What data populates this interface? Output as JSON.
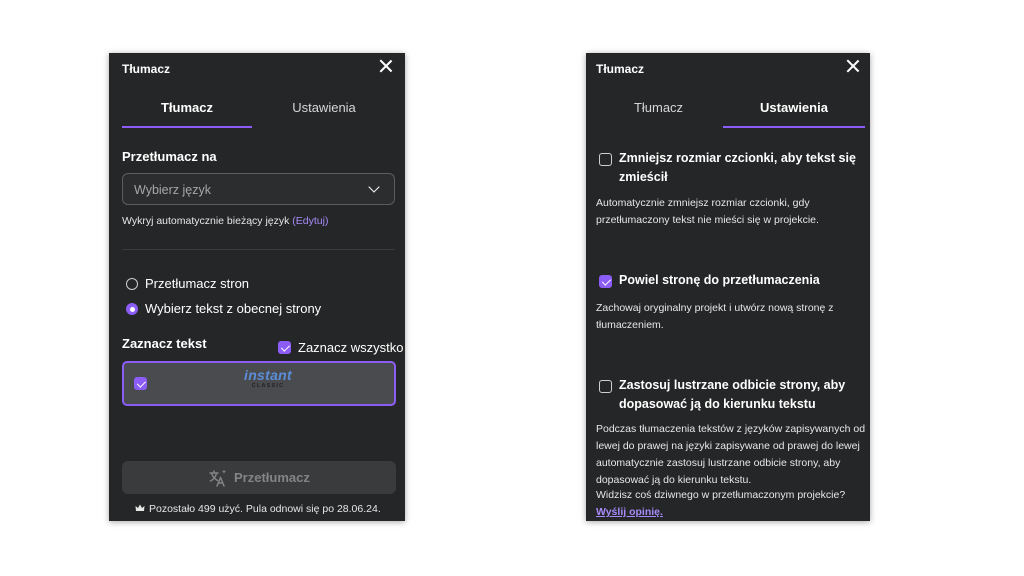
{
  "left_panel": {
    "title": "Tłumacz",
    "tabs": [
      {
        "label": "Tłumacz",
        "active": true
      },
      {
        "label": "Ustawienia",
        "active": false
      }
    ],
    "translate_to_label": "Przetłumacz na",
    "language_select_placeholder": "Wybierz język",
    "detect_text": "Wykryj automatycznie bieżący język",
    "edit_link": "(Edytuj)",
    "radio_options": [
      {
        "label": "Przetłumacz stron",
        "selected": false
      },
      {
        "label": "Wybierz tekst z obecnej strony",
        "selected": true
      }
    ],
    "select_text_label": "Zaznacz tekst",
    "select_all_label": "Zaznacz wszystko",
    "select_all_checked": true,
    "page_card": {
      "logo_main": "instant",
      "logo_sub": "CLASSIC",
      "checked": true
    },
    "translate_button": "Przetłumacz",
    "footer": "Pozostało 499 użyć. Pula odnowi się po 28.06.24."
  },
  "right_panel": {
    "title": "Tłumacz",
    "tabs": [
      {
        "label": "Tłumacz",
        "active": false
      },
      {
        "label": "Ustawienia",
        "active": true
      }
    ],
    "options": [
      {
        "title": "Zmniejsz rozmiar czcionki, aby tekst się zmieścił",
        "checked": false,
        "description": "Automatycznie zmniejsz rozmiar czcionki, gdy przetłumaczony tekst nie mieści się w projekcie."
      },
      {
        "title": "Powiel stronę do przetłumaczenia",
        "checked": true,
        "description": "Zachowaj oryginalny projekt i utwórz nową stronę z tłumaczeniem."
      },
      {
        "title": "Zastosuj lustrzane odbicie strony, aby dopasować ją do kierunku tekstu",
        "checked": false,
        "description": "Podczas tłumaczenia tekstów z języków zapisywanych od lewej do prawej na języki zapisywane od prawej do lewej automatycznie zastosuj lustrzane odbicie strony, aby dopasować ją do kierunku tekstu."
      }
    ],
    "feedback_question": "Widzisz coś dziwnego w przetłumaczonym projekcie?",
    "feedback_link": "Wyślij opinię."
  },
  "colors": {
    "panel_bg": "#252627",
    "accent": "#8b5cf6",
    "link": "#a78bfa"
  }
}
